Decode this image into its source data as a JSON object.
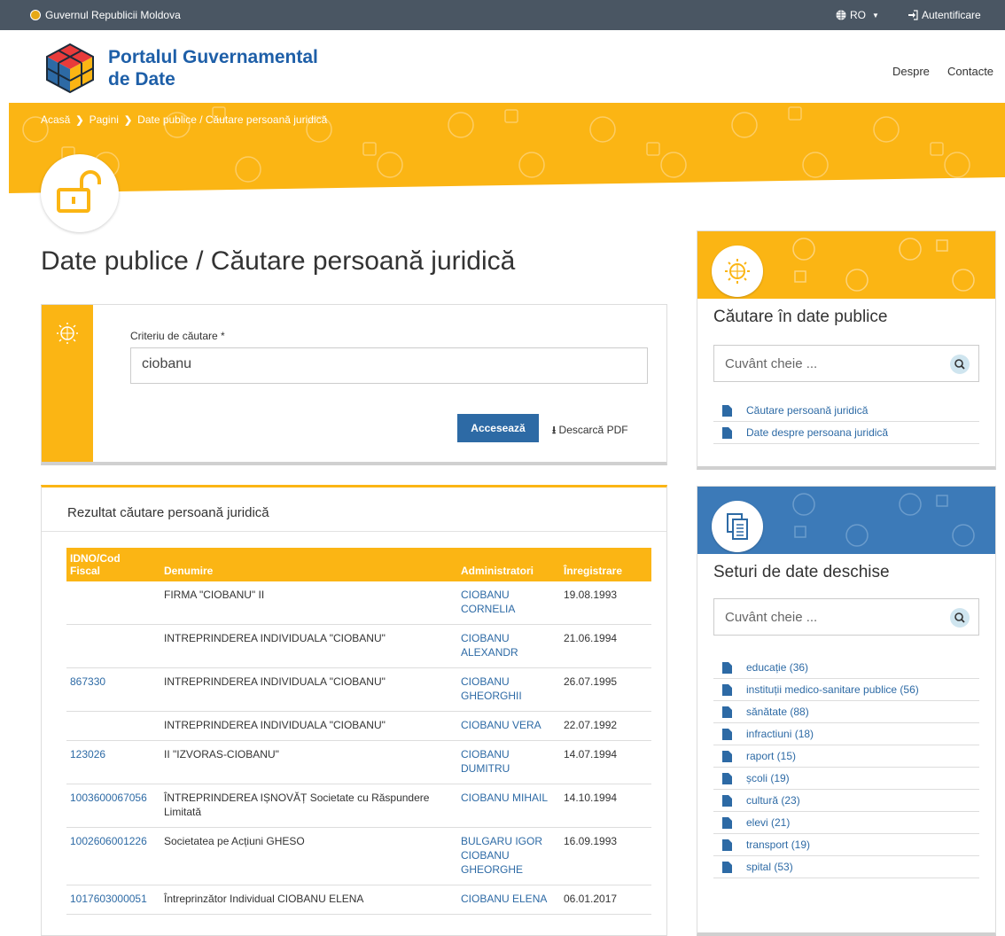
{
  "topbar": {
    "government": "Guvernul Republicii Moldova",
    "language": "RO",
    "login": "Autentificare"
  },
  "brand": {
    "line1": "Portalul Guvernamental",
    "line2": "de Date"
  },
  "nav": {
    "about": "Despre",
    "contacts": "Contacte"
  },
  "breadcrumb": {
    "home": "Acasă",
    "pages": "Pagini",
    "current": "Date publice / Căutare persoană juridică"
  },
  "page_title": "Date publice / Căutare persoană juridică",
  "search": {
    "label": "Criteriu de căutare *",
    "value": "ciobanu",
    "submit": "Accesează",
    "pdf": "Descarcă PDF"
  },
  "results": {
    "title": "Rezultat căutare persoană juridică",
    "columns": {
      "idno_1": "IDNO/Cod",
      "idno_2": "Fiscal",
      "name": "Denumire",
      "admins": "Administratori",
      "registered": "Înregistrare"
    },
    "rows": [
      {
        "idno": "",
        "name": "FIRMA \"CIOBANU\" II",
        "admin": "CIOBANU CORNELIA",
        "date": "19.08.1993"
      },
      {
        "idno": "",
        "name": "INTREPRINDEREA INDIVIDUALA \"CIOBANU\"",
        "admin": "CIOBANU ALEXANDR",
        "date": "21.06.1994"
      },
      {
        "idno": "867330",
        "name": "INTREPRINDEREA INDIVIDUALA \"CIOBANU\"",
        "admin": "CIOBANU GHEORGHII",
        "date": "26.07.1995"
      },
      {
        "idno": "",
        "name": "INTREPRINDEREA INDIVIDUALA \"CIOBANU\"",
        "admin": "CIOBANU VERA",
        "date": "22.07.1992"
      },
      {
        "idno": "123026",
        "name": "II \"IZVORAS-CIOBANU\"",
        "admin": "CIOBANU DUMITRU",
        "date": "14.07.1994"
      },
      {
        "idno": "1003600067056",
        "name": "ÎNTREPRINDEREA IȘNOVĂȚ Societate cu Răspundere Limitată",
        "admin": "CIOBANU MIHAIL",
        "date": "14.10.1994"
      },
      {
        "idno": "1002606001226",
        "name": "Societatea pe Acțiuni GHESO",
        "admin": "BULGARU IGOR CIOBANU GHEORGHE",
        "date": "16.09.1993"
      },
      {
        "idno": "1017603000051",
        "name": "Întreprinzător Individual CIOBANU ELENA",
        "admin": "CIOBANU ELENA",
        "date": "06.01.2017"
      }
    ]
  },
  "public_search": {
    "title": "Căutare în date publice",
    "placeholder": "Cuvânt cheie ...",
    "links": [
      "Căutare persoană juridică",
      "Date despre persoana juridică"
    ]
  },
  "open_datasets": {
    "title": "Seturi de date deschise",
    "placeholder": "Cuvânt cheie ...",
    "links": [
      "educație (36)",
      "instituții medico-sanitare publice (56)",
      "sănătate (88)",
      "infractiuni (18)",
      "raport (15)",
      "școli (19)",
      "cultură (23)",
      "elevi (21)",
      "transport (19)",
      "spital (53)"
    ]
  },
  "colors": {
    "accent": "#fbb514",
    "brand_blue": "#1e5fa8",
    "link": "#2d6aa5",
    "topbar": "#4a5663",
    "panel_blue": "#3c7ab8"
  }
}
